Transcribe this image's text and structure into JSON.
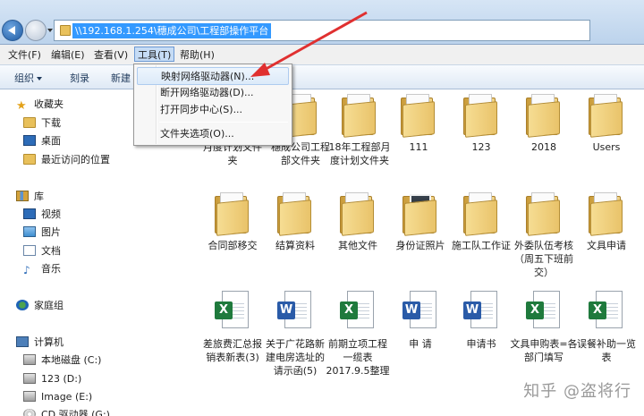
{
  "address": {
    "path": "\\\\192.168.1.254\\穗成公司\\工程部操作平台"
  },
  "menubar": [
    {
      "label": "文件(F)",
      "active": false
    },
    {
      "label": "编辑(E)",
      "active": false
    },
    {
      "label": "查看(V)",
      "active": false
    },
    {
      "label": "工具(T)",
      "active": true
    },
    {
      "label": "帮助(H)",
      "active": false
    }
  ],
  "toolbar": {
    "organize": "组织",
    "burn": "刻录",
    "new": "新建"
  },
  "tools_menu": [
    {
      "label": "映射网络驱动器(N)..."
    },
    {
      "label": "断开网络驱动器(D)..."
    },
    {
      "label": "打开同步中心(S)..."
    },
    {
      "label": "文件夹选项(O)..."
    }
  ],
  "sidebar": {
    "favorites": {
      "label": "收藏夹",
      "items": [
        "下载",
        "桌面",
        "最近访问的位置"
      ]
    },
    "libraries": {
      "label": "库",
      "items": [
        "视频",
        "图片",
        "文档",
        "音乐"
      ]
    },
    "homegroup": "家庭组",
    "computer": {
      "label": "计算机",
      "items": [
        "本地磁盘 (C:)",
        "123 (D:)",
        "Image (E:)",
        "CD 驱动器 (G:)"
      ]
    }
  },
  "files": {
    "row1": [
      {
        "label": "月度计划文件夹",
        "type": "folder"
      },
      {
        "label": "穗成公司工程部文件夹",
        "type": "folder"
      },
      {
        "label": "18年工程部月度计划文件夹",
        "type": "folder"
      },
      {
        "label": "111",
        "type": "folder"
      },
      {
        "label": "123",
        "type": "folder"
      },
      {
        "label": "2018",
        "type": "folder"
      },
      {
        "label": "Users",
        "type": "folder"
      }
    ],
    "row2": [
      {
        "label": "合同部移交",
        "type": "folder"
      },
      {
        "label": "结算资料",
        "type": "folder"
      },
      {
        "label": "其他文件",
        "type": "folder"
      },
      {
        "label": "身份证照片",
        "type": "photo-folder"
      },
      {
        "label": "施工队工作证",
        "type": "folder"
      },
      {
        "label": "外委队伍考核（周五下班前交）",
        "type": "folder"
      },
      {
        "label": "文具申请",
        "type": "folder"
      }
    ],
    "row3": [
      {
        "label": "差旅费汇总报销表新表(3)",
        "type": "xls"
      },
      {
        "label": "关于广花路新建电房选址的请示函(5)",
        "type": "doc"
      },
      {
        "label": "前期立项工程一缆表2017.9.5整理",
        "type": "xls"
      },
      {
        "label": "申 请",
        "type": "doc"
      },
      {
        "label": "申请书",
        "type": "doc"
      },
      {
        "label": "文具申购表=各部门填写",
        "type": "xls"
      },
      {
        "label": "误餐补助一览表",
        "type": "xls"
      }
    ]
  },
  "watermark": "知乎 @盗将行",
  "colors": {
    "selection": "#3399ff",
    "annotation_arrow": "#e03030",
    "menu_highlight": "#c6dcf5"
  }
}
